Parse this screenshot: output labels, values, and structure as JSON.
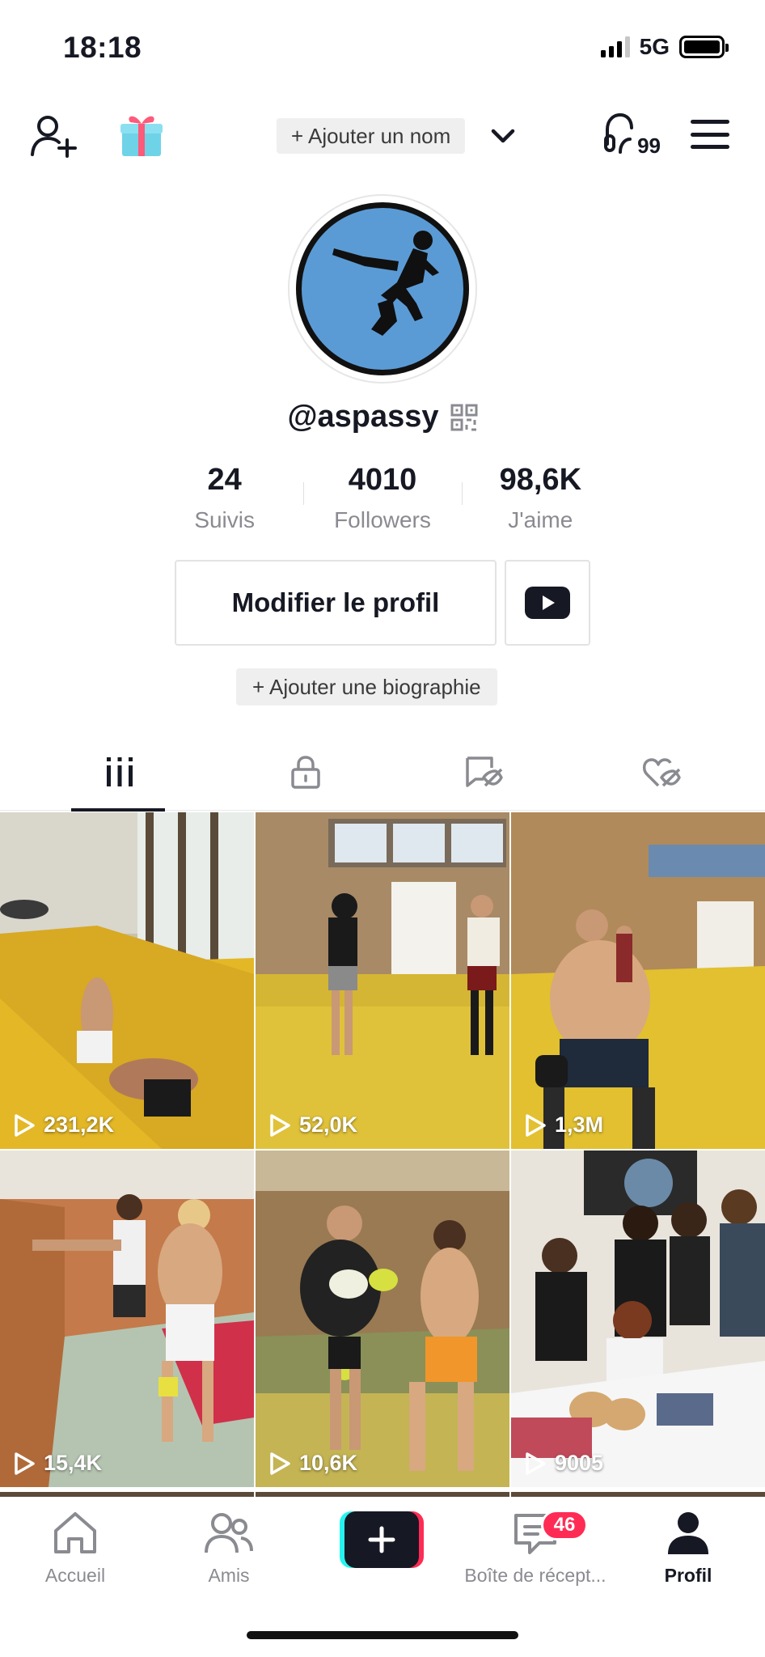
{
  "status_bar": {
    "time": "18:18",
    "network": "5G"
  },
  "header": {
    "add_name_label": "+ Ajouter un nom",
    "headphones_count": "99"
  },
  "profile": {
    "username": "@aspassy",
    "stats": [
      {
        "value": "24",
        "label": "Suivis"
      },
      {
        "value": "4010",
        "label": "Followers"
      },
      {
        "value": "98,6K",
        "label": "J'aime"
      }
    ],
    "edit_button": "Modifier le profil",
    "bio_button": "+ Ajouter une biographie"
  },
  "tabs": [
    {
      "icon": "videos-grid-icon",
      "active": true
    },
    {
      "icon": "lock-icon",
      "active": false
    },
    {
      "icon": "hidden-reposts-icon",
      "active": false
    },
    {
      "icon": "hidden-likes-icon",
      "active": false
    }
  ],
  "videos": [
    {
      "views": "231,2K"
    },
    {
      "views": "52,0K"
    },
    {
      "views": "1,3M"
    },
    {
      "views": "15,4K"
    },
    {
      "views": "10,6K"
    },
    {
      "views": "9005"
    }
  ],
  "bottom_nav": {
    "home": "Accueil",
    "friends": "Amis",
    "inbox": "Boîte de récept...",
    "inbox_badge": "46",
    "profile": "Profil"
  },
  "colors": {
    "accent": "#fe2c55",
    "cyan": "#25f4ee",
    "text": "#161823",
    "muted": "#8a8b91"
  }
}
